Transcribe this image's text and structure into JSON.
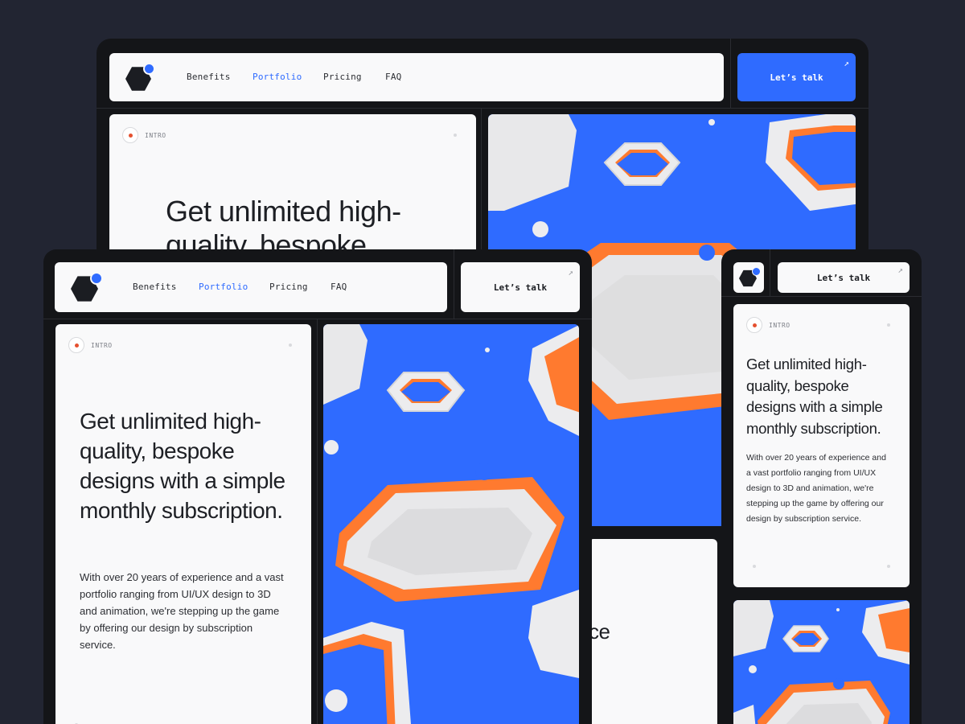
{
  "nav": {
    "links": [
      "Benefits",
      "Portfolio",
      "Pricing",
      "FAQ"
    ],
    "active": "Portfolio",
    "cta_label": "Let’s talk",
    "cta_icon": "arrow-up-right-icon"
  },
  "hero": {
    "tag": "INTRO",
    "headline": "Get unlimited high-quality, bespoke designs with a simple monthly subscription.",
    "headline_partial": "Get unlimited high-quality, bespoke",
    "headline_fragment": "ce",
    "body": "With over 20 years of experience and a vast portfolio ranging from UI/UX design to 3D and animation, we're stepping up the game by offering our design by subscription service."
  },
  "colors": {
    "background": "#222532",
    "device": "#141518",
    "accent": "#2f6bff",
    "intro_dot": "#e5502f",
    "art_orange": "#ff7a2f"
  },
  "icons": {
    "logo": "hexagon-logo-icon",
    "cta": "arrow-up-right-icon"
  }
}
